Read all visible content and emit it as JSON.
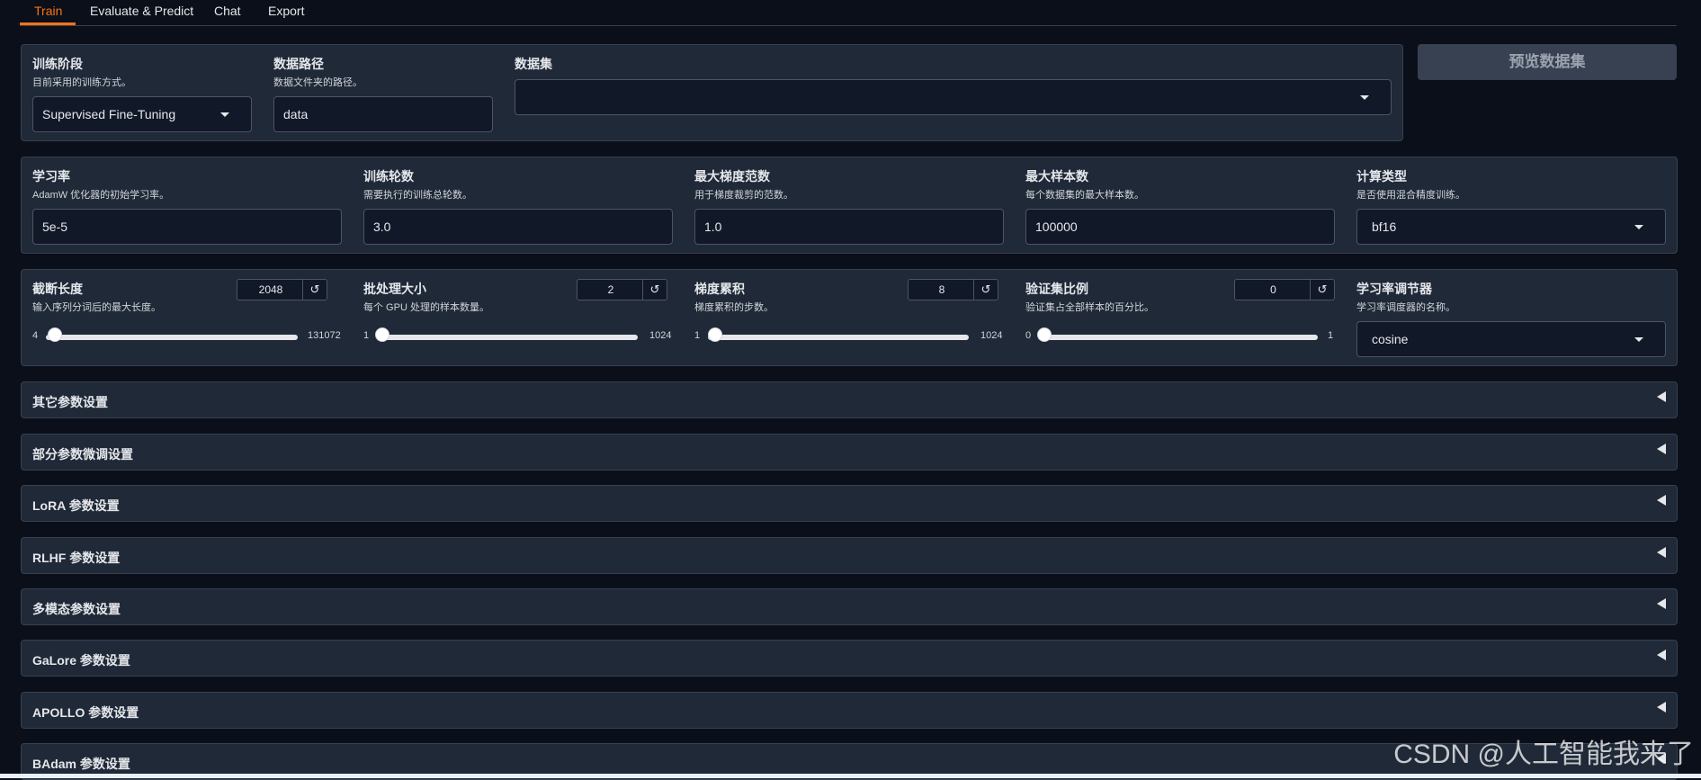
{
  "tabs": [
    "Train",
    "Evaluate & Predict",
    "Chat",
    "Export"
  ],
  "row1": {
    "stage": {
      "label": "训练阶段",
      "info": "目前采用的训练方式。",
      "value": "Supervised Fine-Tuning"
    },
    "data_dir": {
      "label": "数据路径",
      "info": "数据文件夹的路径。",
      "value": "data"
    },
    "dataset": {
      "label": "数据集",
      "value": ""
    },
    "preview_button": "预览数据集"
  },
  "row2": {
    "learning_rate": {
      "label": "学习率",
      "info": "AdamW 优化器的初始学习率。",
      "value": "5e-5"
    },
    "epochs": {
      "label": "训练轮数",
      "info": "需要执行的训练总轮数。",
      "value": "3.0"
    },
    "max_grad_norm": {
      "label": "最大梯度范数",
      "info": "用于梯度裁剪的范数。",
      "value": "1.0"
    },
    "max_samples": {
      "label": "最大样本数",
      "info": "每个数据集的最大样本数。",
      "value": "100000"
    },
    "compute_type": {
      "label": "计算类型",
      "info": "是否使用混合精度训练。",
      "value": "bf16"
    }
  },
  "row3": {
    "cutoff_len": {
      "label": "截断长度",
      "info": "输入序列分词后的最大长度。",
      "value": "2048",
      "min": "4",
      "max": "131072",
      "fraction": 0.015
    },
    "batch_size": {
      "label": "批处理大小",
      "info": "每个 GPU 处理的样本数量。",
      "value": "2",
      "min": "1",
      "max": "1024",
      "fraction": 0.001
    },
    "grad_accum": {
      "label": "梯度累积",
      "info": "梯度累积的步数。",
      "value": "8",
      "min": "1",
      "max": "1024",
      "fraction": 0.007
    },
    "val_size": {
      "label": "验证集比例",
      "info": "验证集占全部样本的百分比。",
      "value": "0",
      "min": "0",
      "max": "1",
      "fraction": 0.0
    },
    "lr_scheduler": {
      "label": "学习率调节器",
      "info": "学习率调度器的名称。",
      "value": "cosine"
    },
    "reset_icon": "↺"
  },
  "accordions": [
    "其它参数设置",
    "部分参数微调设置",
    "LoRA 参数设置",
    "RLHF 参数设置",
    "多模态参数设置",
    "GaLore 参数设置",
    "APOLLO 参数设置",
    "BAdam 参数设置"
  ],
  "watermark": "CSDN @人工智能我来了",
  "colors": {
    "accent": "#f97316",
    "panel": "#1f2937",
    "background": "#0b0f19"
  }
}
